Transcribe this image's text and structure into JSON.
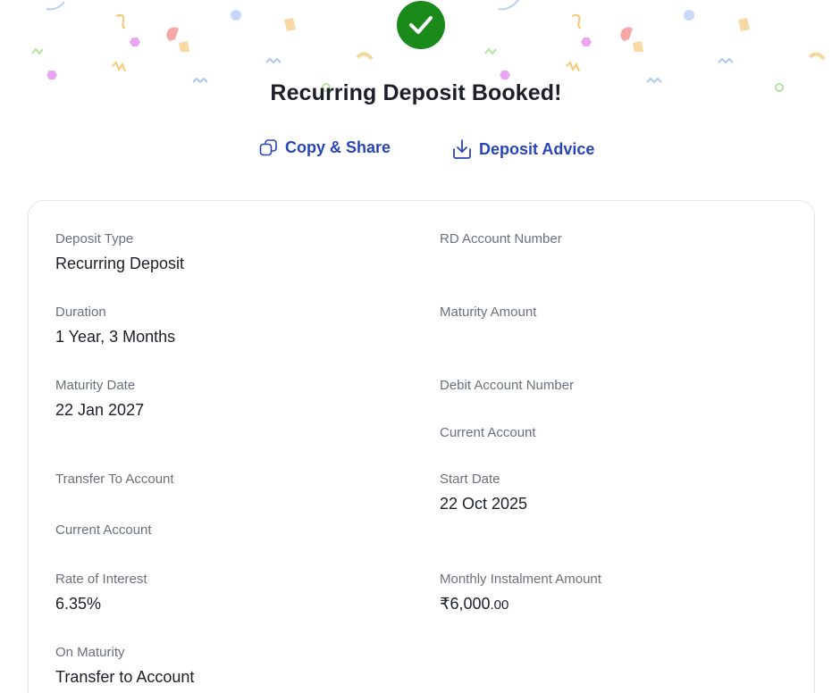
{
  "title": "Recurring Deposit Booked!",
  "actions": {
    "copy_share": "Copy & Share",
    "deposit_advice": "Deposit Advice"
  },
  "colors": {
    "success": "#1a8a1a",
    "link": "#2845b8"
  },
  "details": {
    "deposit_type": {
      "label": "Deposit Type",
      "value": "Recurring Deposit"
    },
    "rd_account_number": {
      "label": "RD Account Number",
      "value": ""
    },
    "duration": {
      "label": "Duration",
      "value": "1 Year, 3 Months"
    },
    "maturity_amount": {
      "label": "Maturity Amount",
      "value": ""
    },
    "maturity_date": {
      "label": "Maturity Date",
      "value": "22 Jan 2027"
    },
    "debit_account_number": {
      "label": "Debit Account Number",
      "value": "",
      "account_type": "Current Account"
    },
    "transfer_to_account": {
      "label": "Transfer To Account",
      "value": "",
      "account_type": "Current Account"
    },
    "start_date": {
      "label": "Start Date",
      "value": "22 Oct 2025"
    },
    "rate_of_interest": {
      "label": "Rate of Interest",
      "value": "6.35%"
    },
    "monthly_instalment": {
      "label": "Monthly Instalment Amount",
      "rupees": "₹6,000",
      "paise": ".00"
    },
    "on_maturity": {
      "label": "On Maturity",
      "value": "Transfer to Account"
    }
  },
  "icons": [
    "check-icon",
    "copy-icon",
    "download-icon"
  ]
}
